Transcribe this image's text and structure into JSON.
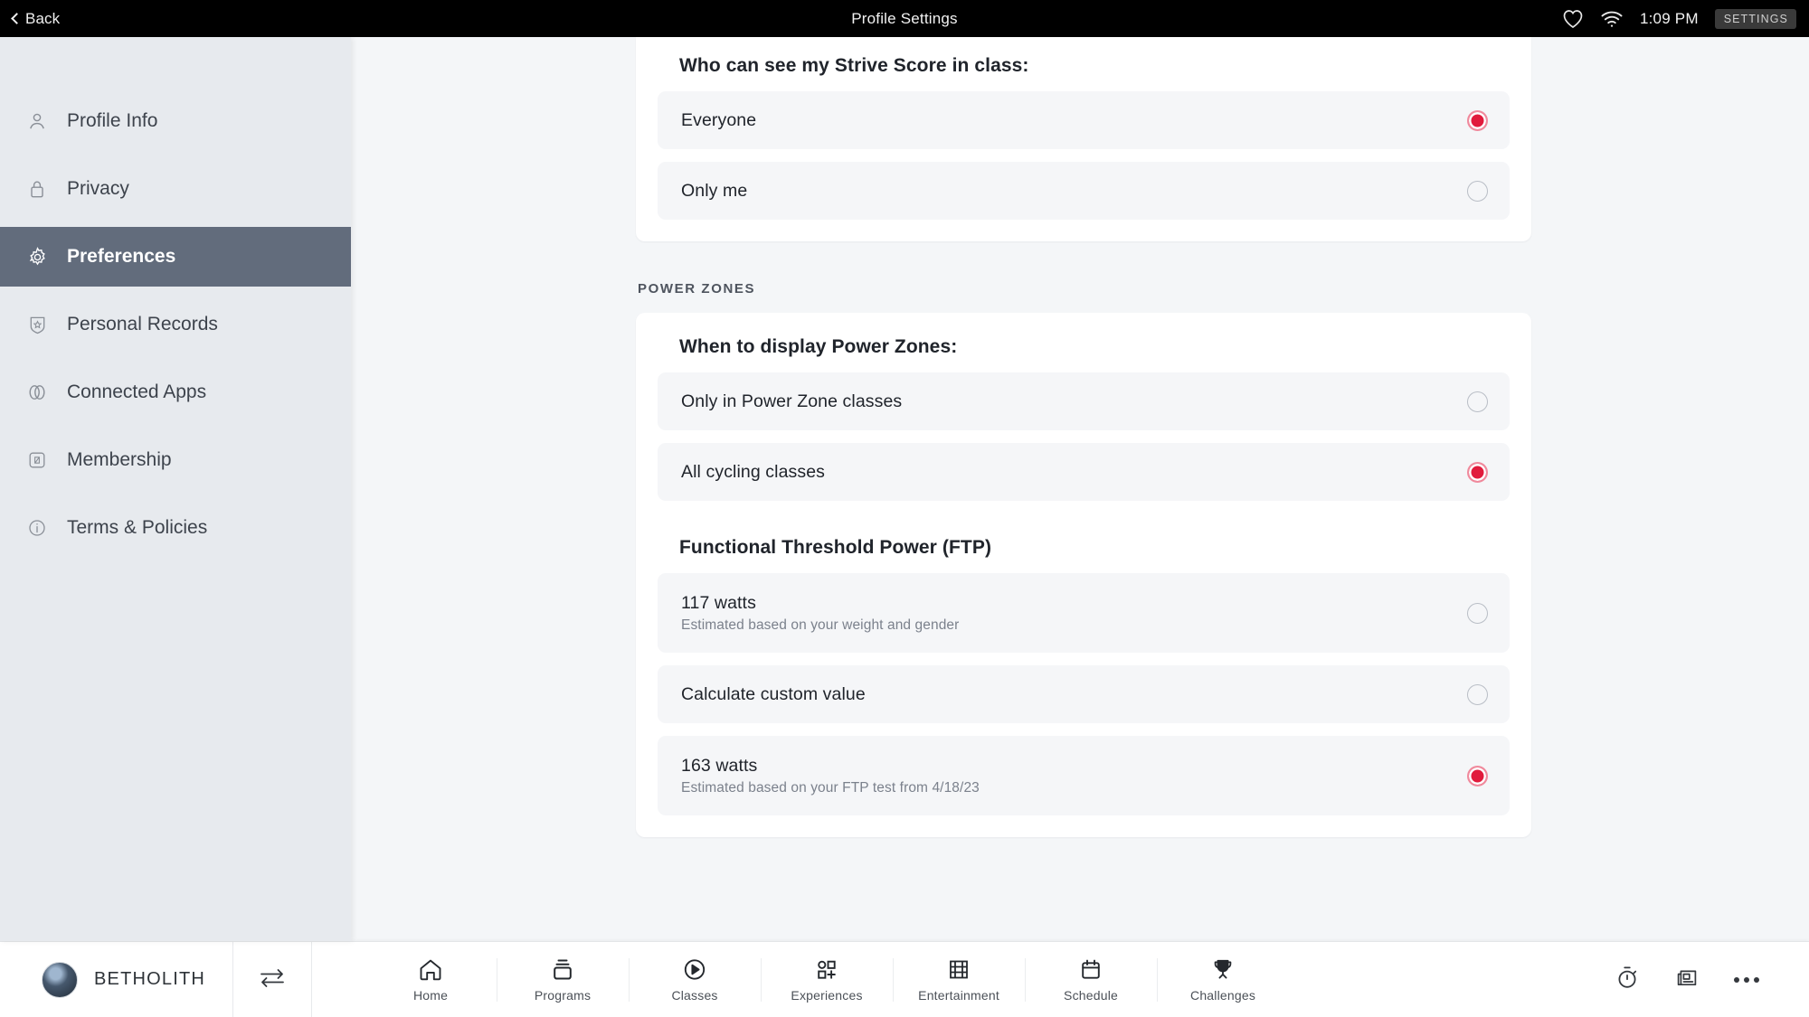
{
  "topbar": {
    "back_label": "Back",
    "title": "Profile Settings",
    "time": "1:09 PM",
    "settings_badge": "SETTINGS",
    "icons": [
      "heart-icon",
      "wifi-icon"
    ]
  },
  "sidebar": {
    "items": [
      {
        "label": "Profile Info",
        "icon": "person-icon",
        "active": false
      },
      {
        "label": "Privacy",
        "icon": "lock-icon",
        "active": false
      },
      {
        "label": "Preferences",
        "icon": "gear-icon",
        "active": true
      },
      {
        "label": "Personal Records",
        "icon": "badge-star-icon",
        "active": false
      },
      {
        "label": "Connected Apps",
        "icon": "link-icon",
        "active": false
      },
      {
        "label": "Membership",
        "icon": "card-icon",
        "active": false
      },
      {
        "label": "Terms & Policies",
        "icon": "info-icon",
        "active": false
      }
    ]
  },
  "main": {
    "strive": {
      "question": "Who can see my Strive Score in class:",
      "options": [
        {
          "label": "Everyone",
          "selected": true
        },
        {
          "label": "Only me",
          "selected": false
        }
      ]
    },
    "power_zones_section_label": "POWER ZONES",
    "power_zones": {
      "question": "When to display Power Zones:",
      "options": [
        {
          "label": "Only in Power Zone classes",
          "selected": false
        },
        {
          "label": "All cycling classes",
          "selected": true
        }
      ],
      "ftp_heading": "Functional Threshold Power (FTP)",
      "ftp_options": [
        {
          "label": "117 watts",
          "sub": "Estimated based on your weight and gender",
          "selected": false
        },
        {
          "label": "Calculate custom value",
          "sub": "",
          "selected": false
        },
        {
          "label": "163 watts",
          "sub": "Estimated based on your FTP test from 4/18/23",
          "selected": true
        }
      ]
    }
  },
  "bottombar": {
    "user_name": "BETHOLITH",
    "avatar": "user-avatar",
    "swap_icon": "switch-user-icon",
    "nav": [
      {
        "label": "Home",
        "icon": "home-icon"
      },
      {
        "label": "Programs",
        "icon": "programs-stack-icon"
      },
      {
        "label": "Classes",
        "icon": "play-circle-icon"
      },
      {
        "label": "Experiences",
        "icon": "grid-plus-icon"
      },
      {
        "label": "Entertainment",
        "icon": "film-strip-icon"
      },
      {
        "label": "Schedule",
        "icon": "calendar-icon"
      },
      {
        "label": "Challenges",
        "icon": "trophy-icon"
      }
    ],
    "right_icons": [
      {
        "icon": "stopwatch-icon"
      },
      {
        "icon": "news-icon"
      },
      {
        "icon": "more-ellipsis-icon"
      }
    ]
  },
  "colors": {
    "accent_red": "#e11b3c",
    "sidebar_bg": "#e7eaee",
    "sidebar_active": "#626c7c",
    "page_bg": "#f4f6f8"
  }
}
